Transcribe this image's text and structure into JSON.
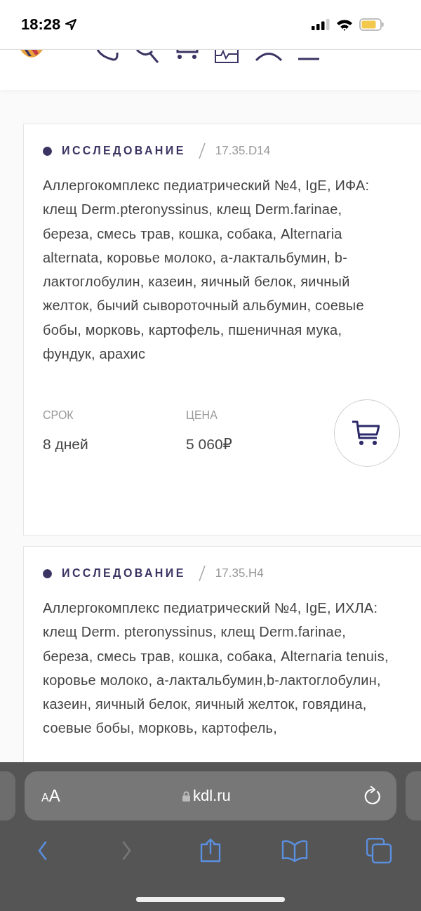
{
  "status_bar": {
    "time": "18:28"
  },
  "cards": [
    {
      "category": "ИССЛЕДОВАНИЕ",
      "code": "17.35.D14",
      "title": "Аллергокомплекс педиатрический №4, IgE, ИФА: клещ Derm.pteronyssinus, клещ Derm.farinae, береза, смесь трав, кошка, собака, Alternaria alternata, коровье молоко, a-лактальбумин, b-лактоглобулин, казеин, яичный белок, яичный желток, бычий сывороточный альбумин, соевые бобы, морковь, картофель, пшеничная мука, фундук, арахис",
      "term_label": "СРОК",
      "term": "8 дней",
      "price_label": "ЦЕНА",
      "price": "5 060₽"
    },
    {
      "category": "ИССЛЕДОВАНИЕ",
      "code": "17.35.H4",
      "title": "Аллергокомплекс педиатрический №4, IgE, ИХЛА: клещ Derm. pteronyssinus, клещ Derm.farinae, береза, смесь трав, кошка, собака, Alternaria tenuis, коровье молоко, a-лактальбумин,b-лактоглобулин, казеин, яичный белок, яичный желток, говядина, соевые бобы, морковь, картофель,"
    }
  ],
  "browser": {
    "text_size_button": "AA",
    "address": "kdl.ru",
    "toolbar": [
      {
        "kind": "back",
        "disabled": false
      },
      {
        "kind": "forward",
        "disabled": true
      },
      {
        "kind": "share",
        "disabled": false
      },
      {
        "kind": "bookmarks",
        "disabled": false
      },
      {
        "kind": "tabs",
        "disabled": false
      }
    ]
  }
}
